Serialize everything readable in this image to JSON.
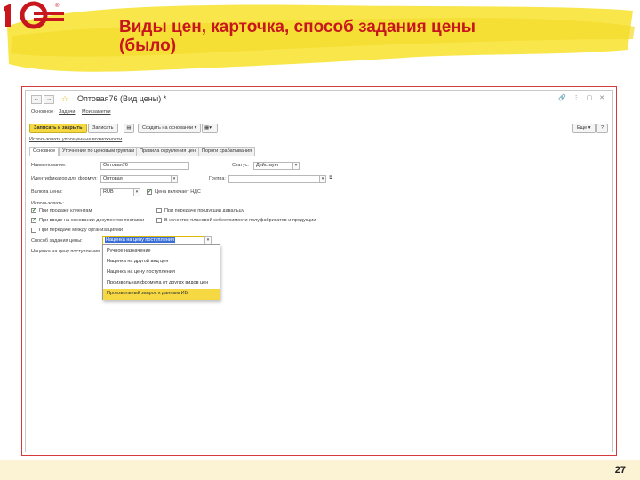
{
  "slide": {
    "title": "Виды цен, карточка, способ задания цены (было)",
    "page_number": "27",
    "brand_color": "#c8161e",
    "highlight_color": "#f6d842"
  },
  "window": {
    "title": "Оптовая76 (Вид цены) *",
    "nav_links": [
      "Основное",
      "Задачи",
      "Мои заметки"
    ],
    "toolbar": {
      "save_close": "Записать и закрыть",
      "save": "Записать",
      "create_based": "Создать на основании",
      "more": "Еще",
      "help": "?"
    },
    "simplified_link": "Использовать упрощенные возможности",
    "tabs": [
      "Основное",
      "Уточнение по ценовым группам",
      "Правила округления цен",
      "Пороги срабатывания"
    ]
  },
  "form": {
    "name_label": "Наименование:",
    "name_value": "Оптовая76",
    "status_label": "Статус:",
    "status_value": "Действует",
    "id_label": "Идентификатор для формул:",
    "id_value": "Оптовая",
    "group_label": "Группа:",
    "group_value": "",
    "currency_label": "Валюта цены:",
    "currency_value": "RUB",
    "vat_label": "Цена включает НДС",
    "vat_checked": true,
    "use_label": "Использовать:",
    "checks": [
      {
        "label": "При продаже клиентам",
        "checked": true
      },
      {
        "label": "При вводе на основании документов поставки",
        "checked": true
      },
      {
        "label": "При передаче между организациями",
        "checked": false
      },
      {
        "label": "При передаче продукции давальцу",
        "checked": false
      },
      {
        "label": "В качестве плановой себестоимости полуфабрикатов и продукции",
        "checked": false
      }
    ],
    "method_label": "Способ задания цены:",
    "method_value": "Наценка на цену поступления",
    "markup_label": "Наценка на цену поступления:"
  },
  "dropdown": {
    "options": [
      "Ручное назначение",
      "Наценка на другой вид цен",
      "Наценка на цену поступления",
      "Произвольная формула от других видов цен",
      "Произвольный запрос к данным ИБ"
    ],
    "selected_index": 4
  }
}
